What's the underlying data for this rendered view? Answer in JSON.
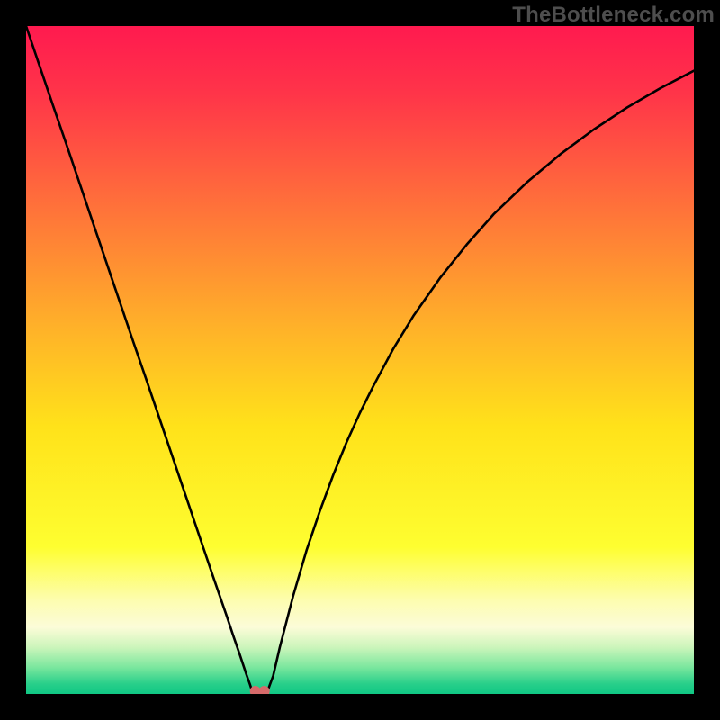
{
  "watermark": "TheBottleneck.com",
  "chart_data": {
    "type": "line",
    "title": "",
    "xlabel": "",
    "ylabel": "",
    "xlim": [
      0,
      100
    ],
    "ylim": [
      0,
      100
    ],
    "x": [
      0,
      2,
      4,
      6,
      8,
      10,
      12,
      14,
      16,
      18,
      20,
      22,
      24,
      26,
      28,
      30,
      31,
      32,
      33,
      33.5,
      34,
      35,
      36,
      37,
      38,
      40,
      42,
      44,
      46,
      48,
      50,
      52,
      55,
      58,
      62,
      66,
      70,
      75,
      80,
      85,
      90,
      95,
      100
    ],
    "values": [
      100,
      94.1,
      88.2,
      82.4,
      76.5,
      70.6,
      64.7,
      58.8,
      52.9,
      47.1,
      41.2,
      35.3,
      29.4,
      23.5,
      17.6,
      11.8,
      8.8,
      5.9,
      2.9,
      1.5,
      0,
      0,
      0,
      2.7,
      7.0,
      14.7,
      21.5,
      27.4,
      32.8,
      37.7,
      42.1,
      46.1,
      51.7,
      56.6,
      62.3,
      67.3,
      71.8,
      76.6,
      80.8,
      84.5,
      87.8,
      90.7,
      93.3
    ],
    "annotations": [
      {
        "type": "marker",
        "x": 35,
        "y": 0,
        "color": "#d66a6a"
      }
    ],
    "background_gradient": {
      "stops": [
        {
          "pos": 0.0,
          "color": "#ff1a4f"
        },
        {
          "pos": 0.1,
          "color": "#ff3449"
        },
        {
          "pos": 0.25,
          "color": "#ff6a3c"
        },
        {
          "pos": 0.45,
          "color": "#ffb129"
        },
        {
          "pos": 0.6,
          "color": "#ffe21a"
        },
        {
          "pos": 0.78,
          "color": "#fefe30"
        },
        {
          "pos": 0.86,
          "color": "#fdfdb0"
        },
        {
          "pos": 0.9,
          "color": "#fcfcd8"
        },
        {
          "pos": 0.93,
          "color": "#ccf5bb"
        },
        {
          "pos": 0.96,
          "color": "#7be79e"
        },
        {
          "pos": 0.985,
          "color": "#28cf8a"
        },
        {
          "pos": 1.0,
          "color": "#10c784"
        }
      ]
    }
  }
}
